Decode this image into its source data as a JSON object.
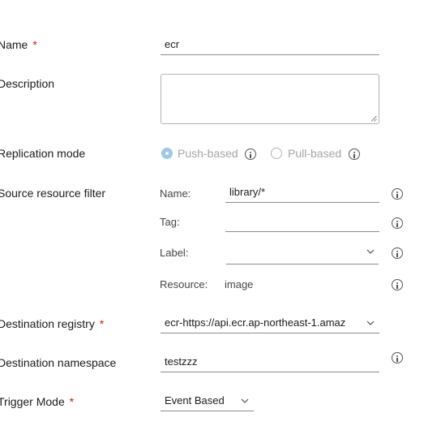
{
  "form": {
    "name": {
      "label": "Name",
      "required": "*",
      "value": "ecr"
    },
    "description": {
      "label": "Description",
      "value": ""
    },
    "replication_mode": {
      "label": "Replication mode",
      "options": [
        {
          "label": "Push-based",
          "selected": true
        },
        {
          "label": "Pull-based",
          "selected": false
        }
      ]
    },
    "source_filter": {
      "label": "Source resource filter",
      "name_label": "Name:",
      "name_value": "library/*",
      "tag_label": "Tag:",
      "tag_value": "",
      "label_label": "Label:",
      "label_value": "",
      "resource_label": "Resource:",
      "resource_value": "image"
    },
    "destination_registry": {
      "label": "Destination registry",
      "required": "*",
      "value": "ecr-https://api.ecr.ap-northeast-1.amaz"
    },
    "destination_namespace": {
      "label": "Destination namespace",
      "value": "testzzz"
    },
    "trigger_mode": {
      "label": "Trigger Mode",
      "required": "*",
      "value": "Event Based"
    }
  },
  "colors": {
    "required": "#c92100",
    "radio_selected": "#9cc9e8",
    "text": "#1b1b1b"
  }
}
